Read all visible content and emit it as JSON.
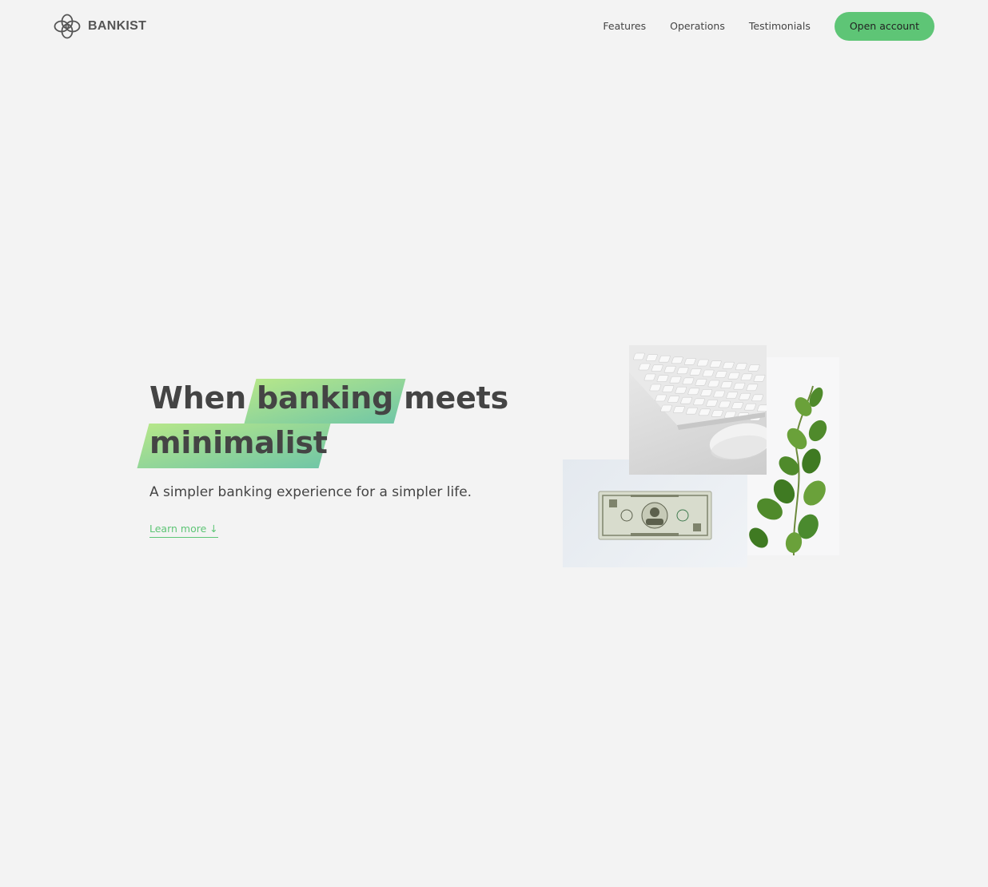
{
  "brand": {
    "name": "BANKIST",
    "logo_icon": "interlocking-rings-icon",
    "accent_color": "#5ec576",
    "highlight_gradient": [
      "#39b385",
      "#9be15d"
    ],
    "text_color": "#444444",
    "background_color": "#f3f3f3"
  },
  "nav": {
    "links": [
      "Features",
      "Operations",
      "Testimonials"
    ],
    "cta_label": "Open account"
  },
  "hero": {
    "headline": {
      "part1": "When",
      "highlight1": "banking",
      "part2": "meets",
      "highlight2": "minimalist"
    },
    "tagline": "A simpler banking experience for a simpler life.",
    "learn_more_label": "Learn more ↓"
  }
}
